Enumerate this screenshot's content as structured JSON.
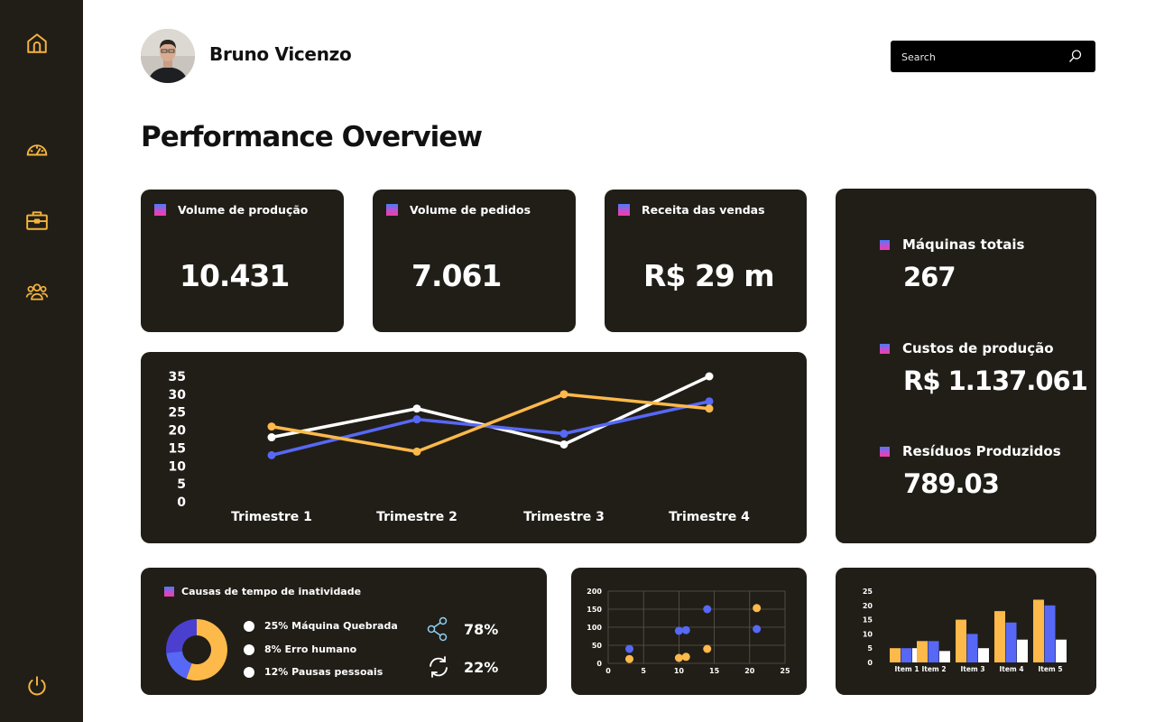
{
  "sidebar": {
    "items": [
      {
        "icon": "home-icon"
      },
      {
        "icon": "gauge-icon"
      },
      {
        "icon": "briefcase-icon"
      },
      {
        "icon": "users-icon"
      }
    ],
    "logout_icon": "power-icon",
    "accent": "#f5b43d"
  },
  "header": {
    "user_name": "Bruno Vicenzo",
    "search_placeholder": "Search"
  },
  "page_title": "Performance Overview",
  "kpis": [
    {
      "label": "Volume de produção",
      "value": "10.431"
    },
    {
      "label": "Volume de pedidos",
      "value": "7.061"
    },
    {
      "label": "Receita das vendas",
      "value": "R$ 29 m"
    }
  ],
  "stats": [
    {
      "label": "Máquinas totais",
      "value": "267"
    },
    {
      "label": "Custos de produção",
      "value": "R$ 1.137.061"
    },
    {
      "label": "Resíduos Produzidos",
      "value": "789.03"
    }
  ],
  "downtime": {
    "title": "Causas de tempo de inatividade",
    "legend": [
      "25% Máquina Quebrada",
      "8% Erro humano",
      "12% Pausas pessoais"
    ],
    "metrics": [
      {
        "icon": "share-icon",
        "value": "78%"
      },
      {
        "icon": "sync-icon",
        "value": "22%"
      }
    ]
  },
  "colors": {
    "white": "#ffffff",
    "blue": "#5668f5",
    "orange": "#fdb94a",
    "card": "#211e18",
    "indigo": "#4b3fcf"
  },
  "chart_data": [
    {
      "type": "line",
      "categories": [
        "Trimestre 1",
        "Trimestre 2",
        "Trimestre 3",
        "Trimestre 4"
      ],
      "ylim": [
        0,
        35
      ],
      "yticks": [
        35,
        30,
        25,
        20,
        15,
        10,
        5,
        0
      ],
      "series": [
        {
          "color": "#ffffff",
          "values": [
            18,
            26,
            16,
            35
          ]
        },
        {
          "color": "#5668f5",
          "values": [
            13,
            23,
            19,
            28
          ]
        },
        {
          "color": "#fdb94a",
          "values": [
            21,
            14,
            30,
            26
          ]
        }
      ]
    },
    {
      "type": "pie",
      "slices": [
        {
          "value": 25,
          "color": "#fdb94a"
        },
        {
          "value": 8,
          "color": "#5668f5"
        },
        {
          "value": 12,
          "color": "#4b3fcf"
        }
      ]
    },
    {
      "type": "scatter",
      "xlim": [
        0,
        25
      ],
      "ylim": [
        0,
        200
      ],
      "xticks": [
        0,
        5,
        10,
        15,
        20,
        25
      ],
      "yticks": [
        200,
        150,
        100,
        50,
        0
      ],
      "grid": true,
      "series": [
        {
          "color": "#5668f5",
          "points": [
            [
              3,
              40
            ],
            [
              10,
              90
            ],
            [
              11,
              92
            ],
            [
              14,
              150
            ],
            [
              21,
              95
            ]
          ]
        },
        {
          "color": "#fdb94a",
          "points": [
            [
              3,
              12
            ],
            [
              10,
              15
            ],
            [
              11,
              18
            ],
            [
              14,
              40
            ],
            [
              21,
              153
            ]
          ]
        }
      ]
    },
    {
      "type": "bar",
      "categories": [
        "Item 1",
        "Item 2",
        "Item 3",
        "Item 4",
        "Item 5"
      ],
      "ylim": [
        0,
        25
      ],
      "yticks": [
        25,
        20,
        15,
        10,
        5,
        0
      ],
      "series": [
        {
          "color": "#5668f5",
          "values": [
            5,
            7.5,
            10,
            14,
            20
          ]
        },
        {
          "color": "#fdb94a",
          "values": [
            5,
            7.5,
            15,
            18,
            22
          ]
        },
        {
          "color": "#ffffff",
          "values": [
            5,
            4,
            5,
            8,
            8
          ]
        }
      ]
    }
  ]
}
